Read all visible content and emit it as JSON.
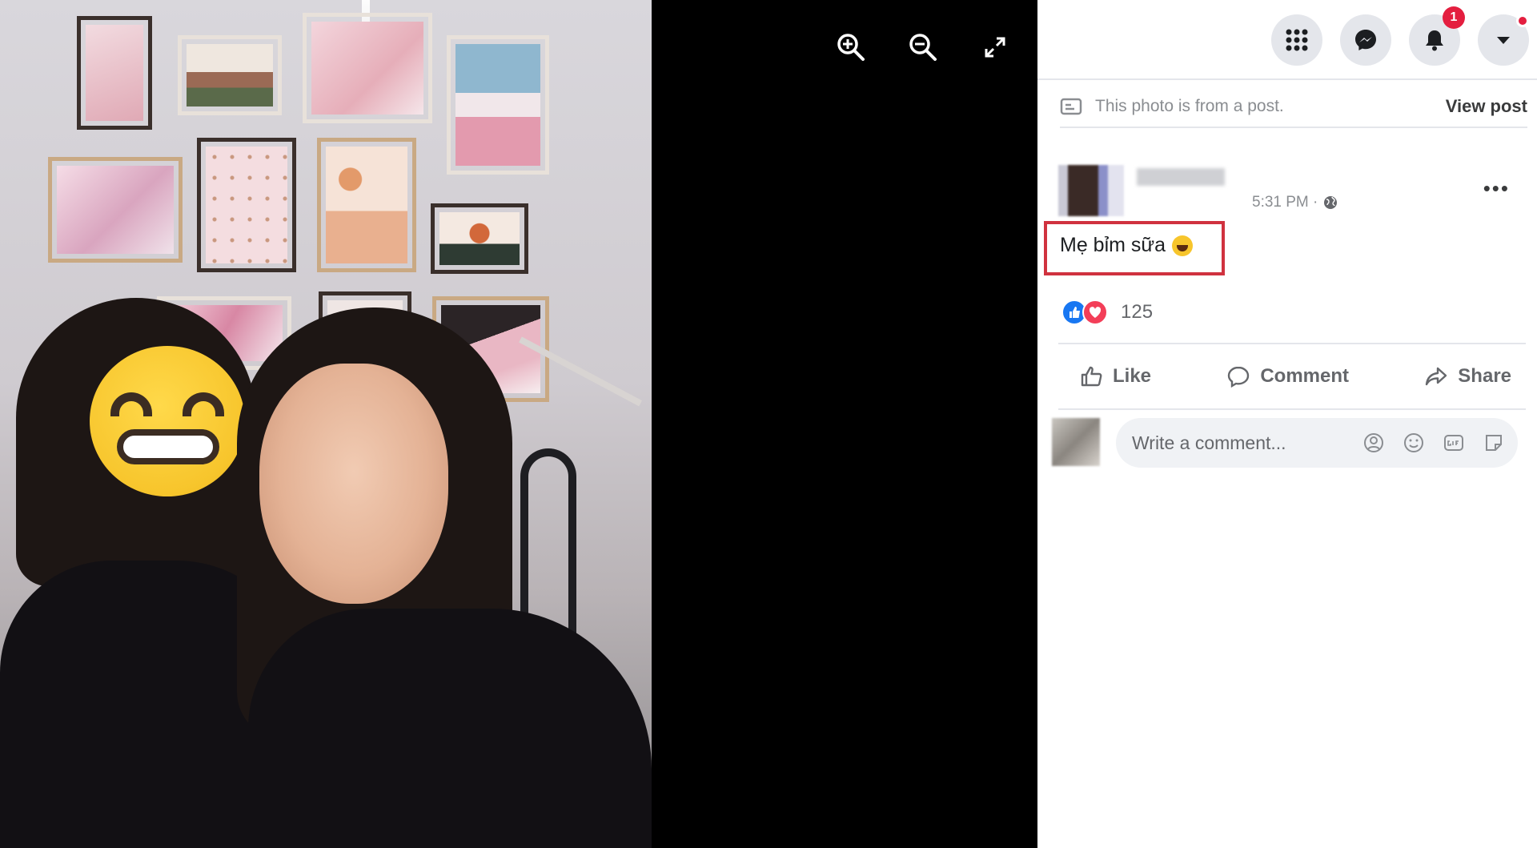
{
  "viewer": {
    "zoom_in_icon": "zoom-in-icon",
    "zoom_out_icon": "zoom-out-icon",
    "fullscreen_icon": "expand-icon"
  },
  "topbar": {
    "icons": [
      "menu-grid-icon",
      "messenger-icon",
      "notifications-bell-icon",
      "account-caret-icon"
    ],
    "notification_count": "1"
  },
  "post": {
    "from_post_text": "This photo is from a post.",
    "view_post_label": "View post",
    "timestamp": "5:31 PM ·",
    "caption": "Mẹ bỉm sữa",
    "reaction_count": "125",
    "actions": {
      "like": "Like",
      "comment": "Comment",
      "share": "Share"
    },
    "comment_placeholder": "Write a comment..."
  },
  "colors": {
    "viewer_background": "#000000",
    "facebook_blue": "#1877f2",
    "love_red": "#f33e58",
    "badge_red": "#e41e3f",
    "highlight_box": "#d0323f"
  }
}
